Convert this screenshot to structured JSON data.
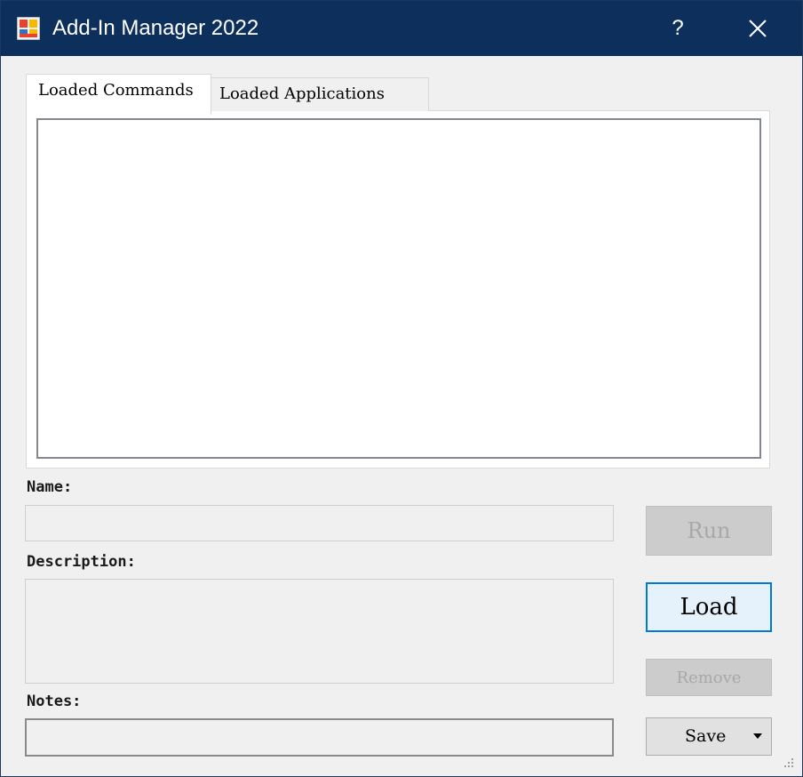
{
  "window": {
    "title": "Add-In Manager 2022",
    "help_label": "?"
  },
  "tabs": [
    {
      "label": "Loaded Commands",
      "active": true
    },
    {
      "label": "Loaded Applications",
      "active": false
    }
  ],
  "fields": {
    "name_label": "Name:",
    "name_value": "",
    "description_label": "Description:",
    "description_value": "",
    "notes_label": "Notes:",
    "notes_value": ""
  },
  "buttons": {
    "run_label": "Run",
    "load_label": "Load",
    "remove_label": "Remove",
    "save_label": "Save"
  },
  "colors": {
    "titlebar": "#0d2f5c",
    "accent": "#0078d7",
    "dialog_bg": "#f0f0f0"
  }
}
